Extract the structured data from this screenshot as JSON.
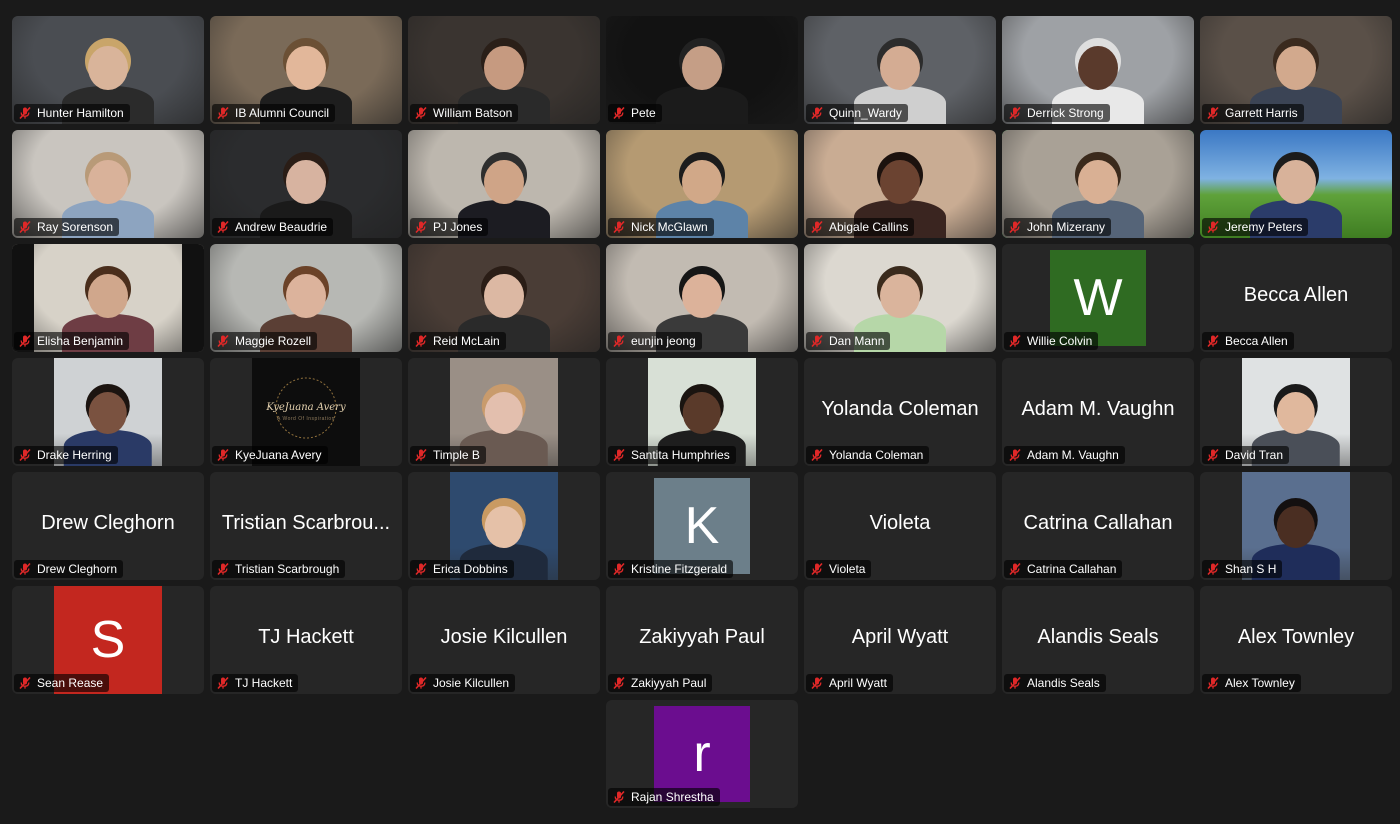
{
  "colors": {
    "background": "#1a1a1a",
    "tile": "#262626",
    "active_speaker_border": "#3ad16a",
    "mic_off": "#e02828"
  },
  "participants": [
    {
      "name": "Hunter Hamilton",
      "kind": "video",
      "bg": "#4a4d52",
      "skin": "#d9b49a",
      "shirt": "#2b2b2b",
      "hair": "#c9a56a"
    },
    {
      "name": "IB Alumni Council",
      "kind": "video",
      "bg": "#7a6a58",
      "skin": "#e2b79a",
      "shirt": "#1e1e1e",
      "hair": "#6b5035"
    },
    {
      "name": "William Batson",
      "kind": "video",
      "bg": "#3a3430",
      "skin": "#c69a80",
      "shirt": "#2a2a2a",
      "hair": "#2a1f18"
    },
    {
      "name": "Pete",
      "kind": "video",
      "bg": "#121212",
      "skin": "#c59e86",
      "shirt": "#1b1b1b",
      "hair": "#222222"
    },
    {
      "name": "Quinn_Wardy",
      "kind": "video",
      "bg": "#5e6166",
      "skin": "#d4ac93",
      "shirt": "#cfcfcf",
      "hair": "#2c2c2c"
    },
    {
      "name": "Derrick Strong",
      "kind": "video",
      "bg": "#9ea1a5",
      "skin": "#5a3a2c",
      "shirt": "#e8e8e8",
      "hair": "#dedede"
    },
    {
      "name": "Garrett Harris",
      "kind": "video",
      "bg": "#5a5048",
      "skin": "#d2a98d",
      "shirt": "#3b4455",
      "hair": "#3a2a1e"
    },
    {
      "name": "Ray Sorenson",
      "kind": "video",
      "bg": "#c9c5bf",
      "skin": "#d9b29a",
      "shirt": "#8da4c0",
      "hair": "#b89a78"
    },
    {
      "name": "Andrew Beaudrie",
      "kind": "video",
      "bg": "#2b2c2e",
      "skin": "#d7b3a0",
      "shirt": "#1a1a1a",
      "hair": "#2a1d16"
    },
    {
      "name": "PJ Jones",
      "kind": "video",
      "bg": "#bdb7ae",
      "skin": "#cfa487",
      "shirt": "#1c1c22",
      "hair": "#2e2e2e"
    },
    {
      "name": "Nick McGlawn",
      "kind": "video",
      "bg": "#b59a72",
      "skin": "#d1a888",
      "shirt": "#5d83a8",
      "hair": "#1c1c1c"
    },
    {
      "name": "Abigale Callins",
      "kind": "video",
      "bg": "#c9ac93",
      "skin": "#6b4331",
      "shirt": "#3a2520",
      "hair": "#1c120e"
    },
    {
      "name": "John Mizerany",
      "kind": "video",
      "bg": "#a9a196",
      "skin": "#d9b094",
      "shirt": "#556478",
      "hair": "#3b2a1c",
      "active": true
    },
    {
      "name": "Jeremy Peters",
      "kind": "video",
      "bg": "#4d7fb8",
      "skin": "#d8b29a",
      "shirt": "#2b3c6a",
      "hair": "#1c1c1c",
      "grass": true
    },
    {
      "name": "Elisha Benjamin",
      "kind": "video",
      "bg": "#d7d2c8",
      "skin": "#d0a78c",
      "shirt": "#6e3d44",
      "hair": "#4a2e1c",
      "letterbox": true
    },
    {
      "name": "Maggie Rozell",
      "kind": "video",
      "bg": "#b7b8b4",
      "skin": "#dcb39c",
      "shirt": "#5b3f35",
      "hair": "#6b4228"
    },
    {
      "name": "Reid McLain",
      "kind": "video",
      "bg": "#4a3d36",
      "skin": "#dcb8a3",
      "shirt": "#2a2a2a",
      "hair": "#2a1d16"
    },
    {
      "name": "eunjin jeong",
      "kind": "video",
      "bg": "#c2bbb2",
      "skin": "#dcb29a",
      "shirt": "#3a3a3a",
      "hair": "#161616"
    },
    {
      "name": "Dan Mann",
      "kind": "video",
      "bg": "#dcd8d0",
      "skin": "#dab49c",
      "shirt": "#b6d7a8",
      "hair": "#3a2a1c"
    },
    {
      "name": "Willie Colvin",
      "kind": "avatar",
      "letter": "W",
      "avatar_bg": "#2f6b22"
    },
    {
      "name": "Becca Allen",
      "kind": "name",
      "display": "Becca Allen"
    },
    {
      "name": "Drake Herring",
      "kind": "photo",
      "bg": "#cfd2d4",
      "skin": "#7a5240",
      "shirt": "#2a3a66",
      "hair": "#1c1410"
    },
    {
      "name": "KyeJuana Avery",
      "kind": "logo",
      "logo_text": "KyeJuana Avery",
      "logo_sub": "A Word Of Inspiration"
    },
    {
      "name": "Timple B",
      "kind": "photo",
      "bg": "#9a8f86",
      "skin": "#e3bfae",
      "shirt": "#6a5a52",
      "hair": "#c99b6c"
    },
    {
      "name": "Santita Humphries",
      "kind": "photo",
      "bg": "#d8e0d6",
      "skin": "#5a3a2a",
      "shirt": "#1e1e1e",
      "hair": "#1a1410"
    },
    {
      "name": "Yolanda Coleman",
      "kind": "name",
      "display": "Yolanda Coleman"
    },
    {
      "name": "Adam M. Vaughn",
      "kind": "name",
      "display": "Adam M. Vaughn"
    },
    {
      "name": "David Tran",
      "kind": "photo",
      "bg": "#dfe2e3",
      "skin": "#e0b89d",
      "shirt": "#4a4f58",
      "hair": "#1a1a1a"
    },
    {
      "name": "Drew Cleghorn",
      "kind": "name",
      "display": "Drew Cleghorn"
    },
    {
      "name": "Tristian Scarbrough",
      "kind": "name",
      "display": "Tristian Scarbrou..."
    },
    {
      "name": "Erica Dobbins",
      "kind": "photo",
      "bg": "#2e4a6e",
      "skin": "#e5c1a8",
      "shirt": "#1f2a3c",
      "hair": "#c99a62"
    },
    {
      "name": "Kristine Fitzgerald",
      "kind": "avatar",
      "letter": "K",
      "avatar_bg": "#6c7f8a"
    },
    {
      "name": "Violeta",
      "kind": "name",
      "display": "Violeta"
    },
    {
      "name": "Catrina Callahan",
      "kind": "name",
      "display": "Catrina Callahan"
    },
    {
      "name": "Shan S H",
      "kind": "photo",
      "bg": "#5a6f8f",
      "skin": "#4a2e22",
      "shirt": "#1f2d5a",
      "hair": "#141010"
    },
    {
      "name": "Sean Rease",
      "kind": "avatar",
      "letter": "S",
      "avatar_bg": "#c3271f",
      "big": true
    },
    {
      "name": "TJ Hackett",
      "kind": "name",
      "display": "TJ Hackett"
    },
    {
      "name": "Josie Kilcullen",
      "kind": "name",
      "display": "Josie Kilcullen"
    },
    {
      "name": "Zakiyyah Paul",
      "kind": "name",
      "display": "Zakiyyah Paul"
    },
    {
      "name": "April Wyatt",
      "kind": "name",
      "display": "April Wyatt"
    },
    {
      "name": "Alandis Seals",
      "kind": "name",
      "display": "Alandis Seals"
    },
    {
      "name": "Alex Townley",
      "kind": "name",
      "display": "Alex Townley"
    },
    {
      "name": "Rajan Shrestha",
      "kind": "avatar",
      "letter": "r",
      "avatar_bg": "#6b0d8f"
    }
  ]
}
